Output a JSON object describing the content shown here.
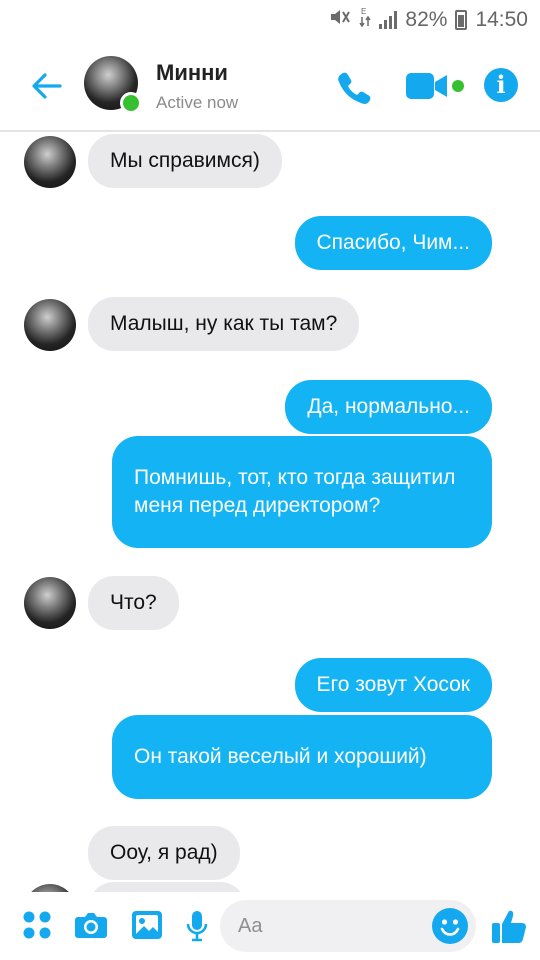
{
  "status_bar": {
    "battery_percent": "82%",
    "time": "14:50"
  },
  "header": {
    "contact_name": "Минни",
    "contact_status": "Active now",
    "accent_color": "#14a8ee",
    "presence_color": "#35c02f"
  },
  "messages": [
    {
      "side": "in",
      "text": "Мы справимся)"
    },
    {
      "side": "out",
      "text": "Спасибо, Чим..."
    },
    {
      "side": "in",
      "text": "Малыш, ну как ты там?"
    },
    {
      "side": "out",
      "text": "Да, нормально..."
    },
    {
      "side": "out",
      "text": "Помнишь, тот, кто тогда защитил меня перед директором?"
    },
    {
      "side": "in",
      "text": "Что?"
    },
    {
      "side": "out",
      "text": "Его зовут Хосок"
    },
    {
      "side": "out",
      "text": "Он такой веселый и хороший)"
    },
    {
      "side": "in",
      "text": "Ооу, я рад)"
    }
  ],
  "composer": {
    "placeholder": "Aa"
  },
  "icons": {
    "back": "back-arrow-icon",
    "call": "phone-icon",
    "video": "video-camera-icon",
    "info": "info-icon",
    "more": "grid-dots-icon",
    "camera": "camera-icon",
    "gallery": "image-icon",
    "mic": "microphone-icon",
    "emoji": "smiley-icon",
    "like": "thumbs-up-icon"
  }
}
